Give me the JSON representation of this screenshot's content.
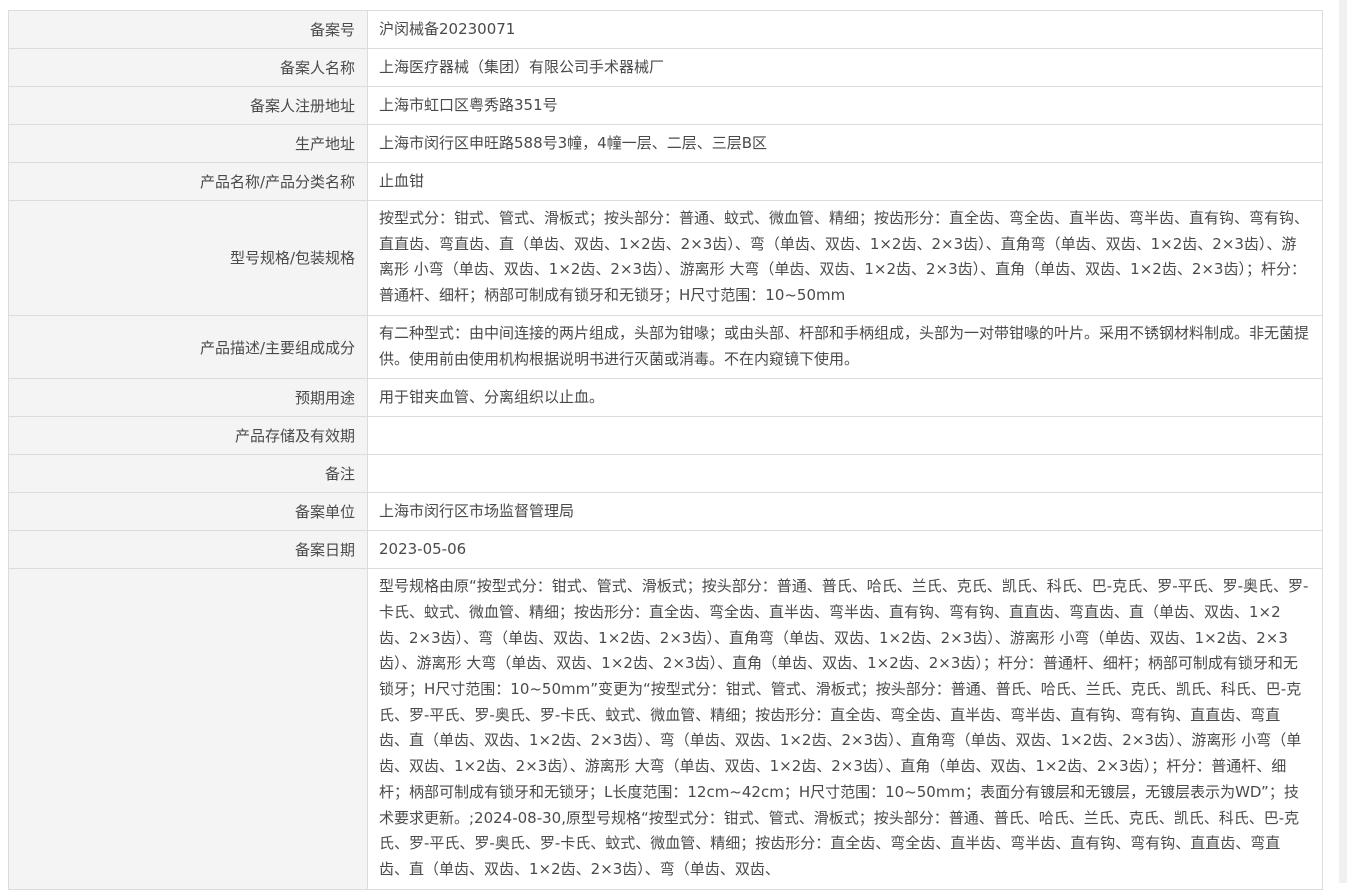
{
  "rows": [
    {
      "label": "备案号",
      "value": "沪闵械备20230071"
    },
    {
      "label": "备案人名称",
      "value": "上海医疗器械（集团）有限公司手术器械厂"
    },
    {
      "label": "备案人注册地址",
      "value": "上海市虹口区粤秀路351号"
    },
    {
      "label": "生产地址",
      "value": "上海市闵行区申旺路588号3幢，4幢一层、二层、三层B区"
    },
    {
      "label": "产品名称/产品分类名称",
      "value": "止血钳"
    },
    {
      "label": "型号规格/包装规格",
      "value": "按型式分：钳式、管式、滑板式；按头部分：普通、蚊式、微血管、精细；按齿形分：直全齿、弯全齿、直半齿、弯半齿、直有钩、弯有钩、直直齿、弯直齿、直（单齿、双齿、1×2齿、2×3齿）、弯（单齿、双齿、1×2齿、2×3齿）、直角弯（单齿、双齿、1×2齿、2×3齿）、游离形 小弯（单齿、双齿、1×2齿、2×3齿）、游离形 大弯（单齿、双齿、1×2齿、2×3齿）、直角（单齿、双齿、1×2齿、2×3齿）；杆分：普通杆、细杆；柄部可制成有锁牙和无锁牙；H尺寸范围：10~50mm"
    },
    {
      "label": "产品描述/主要组成成分",
      "value": "有二种型式：由中间连接的两片组成，头部为钳喙；或由头部、杆部和手柄组成，头部为一对带钳喙的叶片。采用不锈钢材料制成。非无菌提供。使用前由使用机构根据说明书进行灭菌或消毒。不在内窥镜下使用。"
    },
    {
      "label": "预期用途",
      "value": "用于钳夹血管、分离组织以止血。"
    },
    {
      "label": "产品存储及有效期",
      "value": ""
    },
    {
      "label": "备注",
      "value": ""
    },
    {
      "label": "备案单位",
      "value": "上海市闵行区市场监督管理局"
    },
    {
      "label": "备案日期",
      "value": "2023-05-06"
    },
    {
      "label": "",
      "value": "型号规格由原“按型式分：钳式、管式、滑板式；按头部分：普通、普氏、哈氏、兰氏、克氏、凯氏、科氏、巴-克氏、罗-平氏、罗-奥氏、罗-卡氏、蚊式、微血管、精细；按齿形分：直全齿、弯全齿、直半齿、弯半齿、直有钩、弯有钩、直直齿、弯直齿、直（单齿、双齿、1×2齿、2×3齿）、弯（单齿、双齿、1×2齿、2×3齿）、直角弯（单齿、双齿、1×2齿、2×3齿）、游离形 小弯（单齿、双齿、1×2齿、2×3齿）、游离形 大弯（单齿、双齿、1×2齿、2×3齿）、直角（单齿、双齿、1×2齿、2×3齿）；杆分：普通杆、细杆；柄部可制成有锁牙和无锁牙；H尺寸范围：10~50mm”变更为“按型式分：钳式、管式、滑板式；按头部分：普通、普氏、哈氏、兰氏、克氏、凯氏、科氏、巴-克氏、罗-平氏、罗-奥氏、罗-卡氏、蚊式、微血管、精细；按齿形分：直全齿、弯全齿、直半齿、弯半齿、直有钩、弯有钩、直直齿、弯直齿、直（单齿、双齿、1×2齿、2×3齿）、弯（单齿、双齿、1×2齿、2×3齿）、直角弯（单齿、双齿、1×2齿、2×3齿）、游离形 小弯（单齿、双齿、1×2齿、2×3齿）、游离形 大弯（单齿、双齿、1×2齿、2×3齿）、直角（单齿、双齿、1×2齿、2×3齿）；杆分：普通杆、细杆；柄部可制成有锁牙和无锁牙；L长度范围：12cm~42cm；H尺寸范围：10~50mm；表面分有镀层和无镀层，无镀层表示为WD”；技术要求更新。;2024-08-30,原型号规格“按型式分：钳式、管式、滑板式；按头部分：普通、普氏、哈氏、兰氏、克氏、凯氏、科氏、巴-克氏、罗-平氏、罗-奥氏、罗-卡氏、蚊式、微血管、精细；按齿形分：直全齿、弯全齿、直半齿、弯半齿、直有钩、弯有钩、直直齿、弯直齿、直（单齿、双齿、1×2齿、2×3齿）、弯（单齿、双齿、"
    }
  ]
}
